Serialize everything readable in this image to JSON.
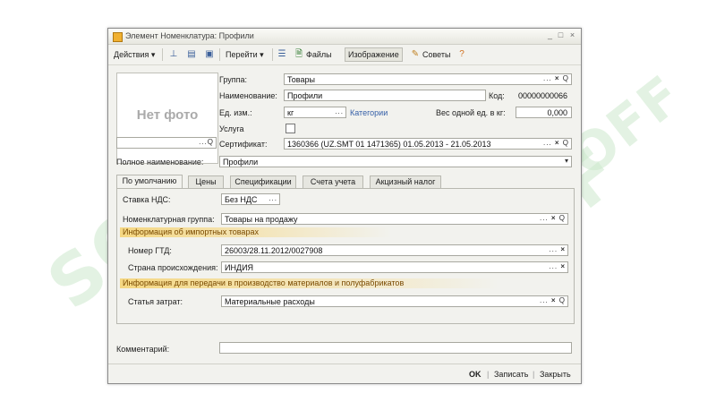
{
  "window": {
    "title": "Элемент Номенклатура: Профили",
    "min_label": "_",
    "max_label": "□",
    "close_label": "×"
  },
  "toolbar": {
    "actions_label": "Действия ▾",
    "goto_label": "Перейти ▾",
    "files_label": "Файлы",
    "image_label": "Изображение",
    "tips_label": "Советы"
  },
  "photo": {
    "no_photo": "Нет фото",
    "lookup_btns": "...Q"
  },
  "header": {
    "group_label": "Группа:",
    "group_value": "Товары",
    "name_label": "Наименование:",
    "name_value": "Профили",
    "code_label": "Код:",
    "code_value": "00000000066",
    "unit_label": "Ед. изм.:",
    "unit_value": "кг",
    "categories_link": "Категории",
    "weight_label": "Вес одной ед. в кг:",
    "weight_value": "0,000",
    "service_label": "Услуга",
    "cert_label": "Сертификат:",
    "cert_value": "1360366 (UZ.SMT 01   1471365) 01.05.2013 - 21.05.2013",
    "fullname_label": "Полное наименование:",
    "fullname_value": "Профили"
  },
  "tabs": [
    {
      "label": "По умолчанию"
    },
    {
      "label": "Цены"
    },
    {
      "label": "Спецификации"
    },
    {
      "label": "Счета учета"
    },
    {
      "label": "Акцизный налог"
    }
  ],
  "defaults_tab": {
    "vat_label": "Ставка НДС:",
    "vat_value": "Без НДС",
    "nomgroup_label": "Номенклатурная группа:",
    "nomgroup_value": "Товары на продажу",
    "import_header": "Информация об импортных товарах",
    "gtd_label": "Номер ГТД:",
    "gtd_value": "26003/28.11.2012/0027908",
    "country_label": "Страна происхождения:",
    "country_value": "ИНДИЯ",
    "transfer_header": "Информация для передачи в производство материалов и полуфабрикатов",
    "cost_label": "Статья затрат:",
    "cost_value": "Материальные расходы"
  },
  "comment": {
    "label": "Комментарий:",
    "value": ""
  },
  "footer": {
    "ok_label": "OK",
    "save_label": "Записать",
    "close_label": "Закрыть",
    "divider": "|"
  },
  "watermark": {
    "text": "SOFF"
  },
  "colors": {
    "group_header": "#f5d782",
    "link": "#3660a8",
    "window_bg": "#f2f2ee"
  }
}
